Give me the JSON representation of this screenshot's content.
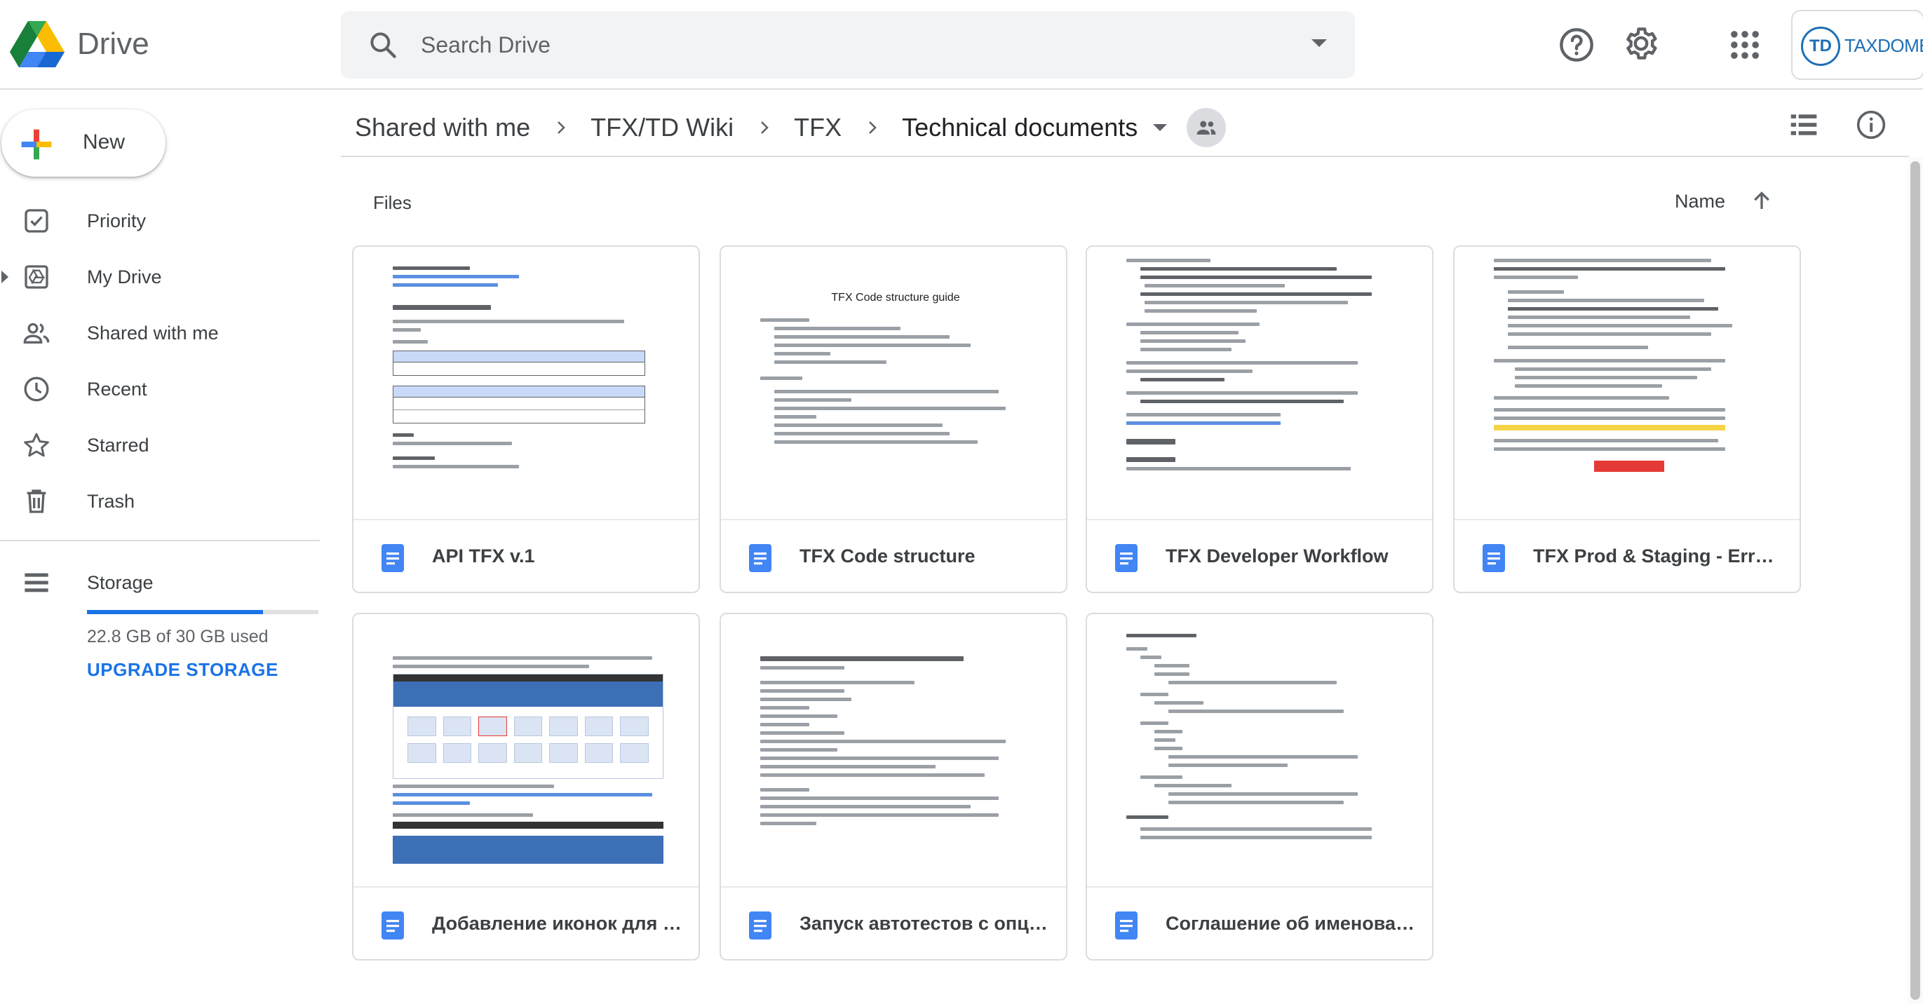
{
  "app": {
    "name": "Drive",
    "account_label": "TAXDOME",
    "account_mark": "TD"
  },
  "search": {
    "placeholder": "Search Drive"
  },
  "sidebar": {
    "new_label": "New",
    "items": [
      {
        "label": "Priority",
        "icon": "priority-icon"
      },
      {
        "label": "My Drive",
        "icon": "my-drive-icon"
      },
      {
        "label": "Shared with me",
        "icon": "shared-icon"
      },
      {
        "label": "Recent",
        "icon": "clock-icon"
      },
      {
        "label": "Starred",
        "icon": "star-icon"
      },
      {
        "label": "Trash",
        "icon": "trash-icon"
      }
    ],
    "storage": {
      "label": "Storage",
      "usage_text": "22.8 GB of 30 GB used",
      "used_fraction": 0.76,
      "upgrade_label": "UPGRADE STORAGE"
    }
  },
  "breadcrumb": [
    "Shared with me",
    "TFX/TD Wiki",
    "TFX",
    "Technical documents"
  ],
  "content": {
    "section_title": "Files",
    "sort_label": "Name",
    "files": [
      {
        "name": "API TFX v.1",
        "type": "google-doc"
      },
      {
        "name": "TFX Code structure",
        "type": "google-doc",
        "thumb_title": "TFX Code structure guide"
      },
      {
        "name": "TFX Developer Workflow",
        "type": "google-doc"
      },
      {
        "name": "TFX Prod & Staging - Error H...",
        "type": "google-doc"
      },
      {
        "name": "Добавление иконок для ка...",
        "type": "google-doc"
      },
      {
        "name": "Запуск автотестов с опцие...",
        "type": "google-doc"
      },
      {
        "name": "Соглашение об именовании",
        "type": "google-doc"
      }
    ]
  },
  "colors": {
    "accent": "#1a73e8",
    "doc_icon": "#4285f4",
    "divider": "#dadce0"
  }
}
